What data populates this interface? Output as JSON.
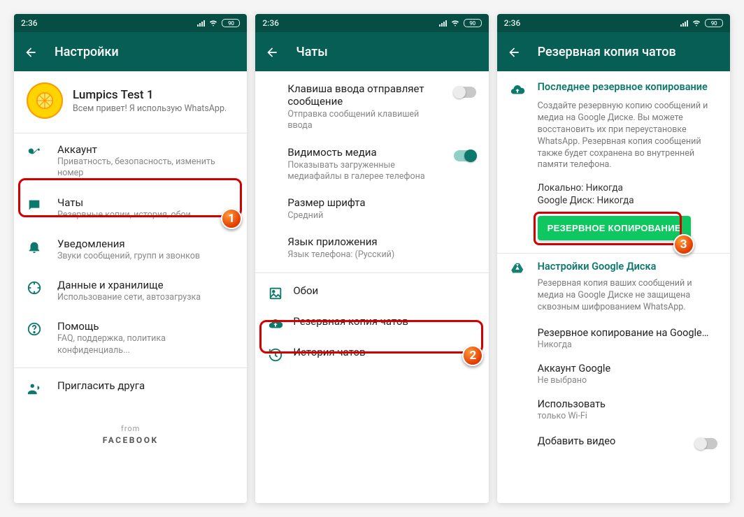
{
  "status": {
    "time": "2:36",
    "battery": "90"
  },
  "screen1": {
    "title": "Настройки",
    "profile_name": "Lumpics Test 1",
    "profile_status": "Всем привет! Я использую WhatsApp.",
    "items": [
      {
        "icon": "key",
        "title": "Аккаунт",
        "sub": "Приватность, безопасность, изменить номер"
      },
      {
        "icon": "chat",
        "title": "Чаты",
        "sub": "Резервные копии, история, обои"
      },
      {
        "icon": "bell",
        "title": "Уведомления",
        "sub": "Звуки сообщений, групп и звонков"
      },
      {
        "icon": "data",
        "title": "Данные и хранилище",
        "sub": "Использование сети, автозагрузка"
      },
      {
        "icon": "help",
        "title": "Помощь",
        "sub": "FAQ, поддержка, политика конфиденциаль..."
      },
      {
        "icon": "invite",
        "title": "Пригласить друга",
        "sub": ""
      }
    ],
    "from": "from",
    "facebook": "FACEBOOK",
    "badge": "1"
  },
  "screen2": {
    "title": "Чаты",
    "enter_send_title": "Клавиша ввода отправляет сообщение",
    "enter_send_sub": "Отправка сообщений клавишей ввода",
    "media_vis_title": "Видимость медиа",
    "media_vis_sub": "Показывать загруженные медиафайлы в галерее телефона",
    "font_title": "Размер шрифта",
    "font_sub": "Средний",
    "lang_title": "Язык приложения",
    "lang_sub": "Язык телефона: (Русский)",
    "wallpaper": "Обои",
    "backup": "Резервная копия чатов",
    "history": "История чатов",
    "badge": "2"
  },
  "screen3": {
    "title": "Резервная копия чатов",
    "last_backup_title": "Последнее резервное копирование",
    "last_backup_desc": "Создайте резервную копию сообщений и медиа на Google Диске. Вы можете восстановить их при переустановке WhatsApp. Резервная копия сообщений также будет сохранена во внутренней памяти телефона.",
    "local_label": "Локально: Никогда",
    "gdrive_label": "Google Диск: Никогда",
    "backup_btn": "РЕЗЕРВНОЕ КОПИРОВАНИЕ",
    "gdrive_settings_title": "Настройки Google Диска",
    "gdrive_settings_desc": "Резервная копия ваших сообщений и медиа на Google Диске не защищена сквозным шифрованием WhatsApp.",
    "freq_title": "Резервное копирование на Google…",
    "freq_sub": "Никогда",
    "account_title": "Аккаунт Google",
    "account_sub": "Не выбрано",
    "net_title": "Использовать",
    "net_sub": "только Wi-Fi",
    "video_title": "Добавить видео",
    "badge": "3"
  }
}
